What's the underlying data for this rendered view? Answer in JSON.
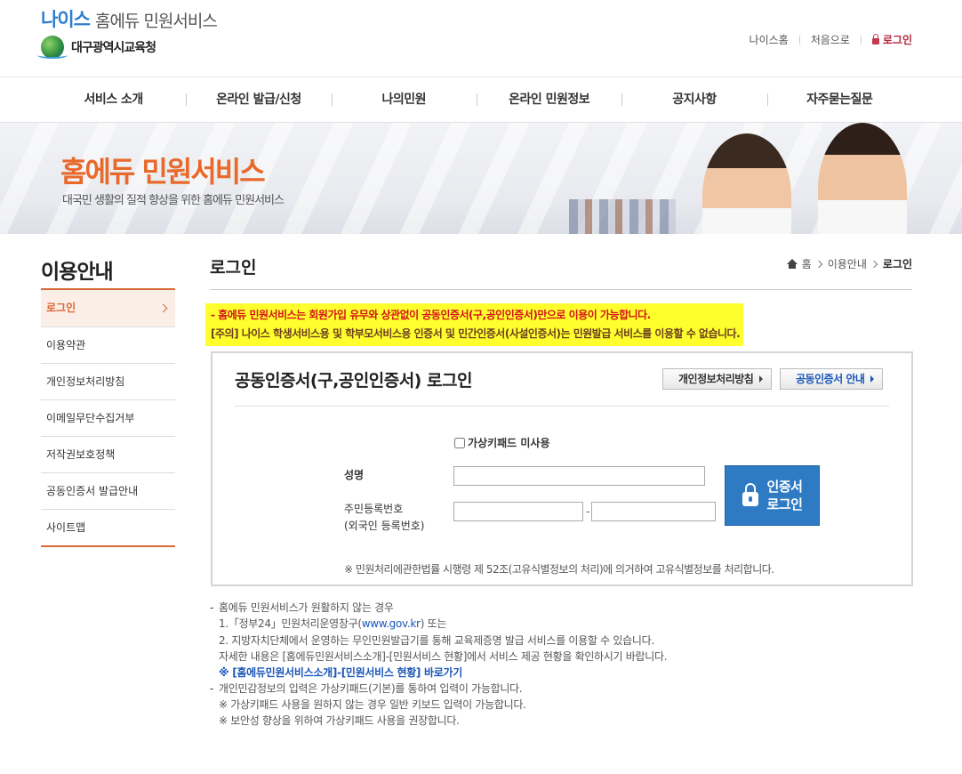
{
  "header": {
    "logo_neis": "나이스",
    "logo_service": "홈에듀 민원서비스",
    "logo_org": "대구광역시교육청",
    "util": {
      "neis_home": "나이스홈",
      "home": "처음으로",
      "login": "로그인"
    }
  },
  "gnb": [
    "서비스 소개",
    "온라인 발급/신청",
    "나의민원",
    "온라인 민원정보",
    "공지사항",
    "자주묻는질문"
  ],
  "banner": {
    "title": "홈에듀 민원서비스",
    "subtitle": "대국민 생활의 질적 향상을 위한 홈에듀 민원서비스"
  },
  "lnb": {
    "title": "이용안내",
    "items": [
      "로그인",
      "이용약관",
      "개인정보처리방침",
      "이메일무단수집거부",
      "저작권보호정책",
      "공동인증서 발급안내",
      "사이트맵"
    ]
  },
  "content": {
    "title": "로그인",
    "breadcrumb": {
      "home": "홈",
      "level1": "이용안내",
      "current": "로그인"
    },
    "notice_line1": "- 홈에듀 민원서비스는 회원가입 유무와 상관없이 공동인증서(구,공인인증서)만으로 이용이 가능합니다.",
    "notice_line2": "[주의] 나이스 학생서비스용 및 학부모서비스용 인증서 및 민간인증서(사설인증서)는 민원발급 서비스를 이용할 수 없습니다.",
    "login_box": {
      "title": "공동인증서(구,공인인증서) 로그인",
      "btn_privacy": "개인정보처리방침",
      "btn_cert_info": "공동인증서 안내",
      "vkeypad_label": "가상키패드 미사용",
      "name_label": "성명",
      "rrn_label_1": "주민등록번호",
      "rrn_label_2": "(외국인 등록번호)",
      "cert_btn_line1": "인증서",
      "cert_btn_line2": "로그인",
      "legal_note": "※ 민원처리에관한법률 시행령 제 52조(고유식별정보의 처리)에 의거하여 고유식별정보를 처리합니다."
    },
    "guide": {
      "item1_title": "홈에듀 민원서비스가 원활하지 않는 경우",
      "item1_sub1_prefix": "1.「정부24」민원처리운영창구(",
      "item1_sub1_link": "www.gov.kr",
      "item1_sub1_suffix": ") 또는",
      "item1_sub2": "2. 지방자치단체에서 운영하는 무인민원발급기를 통해 교육제증명 발급 서비스를 이용할 수 있습니다.",
      "item1_sub3": "자세한 내용은 [홈에듀민원서비스소개]-[민원서비스 현황]에서 서비스 제공 현황을 확인하시기 바랍니다.",
      "item1_link": "※ [홈에듀민원서비스소개]-[민원서비스 현황] 바로가기",
      "item2_title": "개인민감정보의 입력은 가상키패드(기본)를 통하여 입력이 가능합니다.",
      "item2_sub1": "※ 가상키패드 사용을 원하지 않는 경우 일반 키보드 입력이 가능합니다.",
      "item2_sub2": "※ 보안성 향상을 위하여 가상키패드 사용을 권장합니다."
    }
  }
}
